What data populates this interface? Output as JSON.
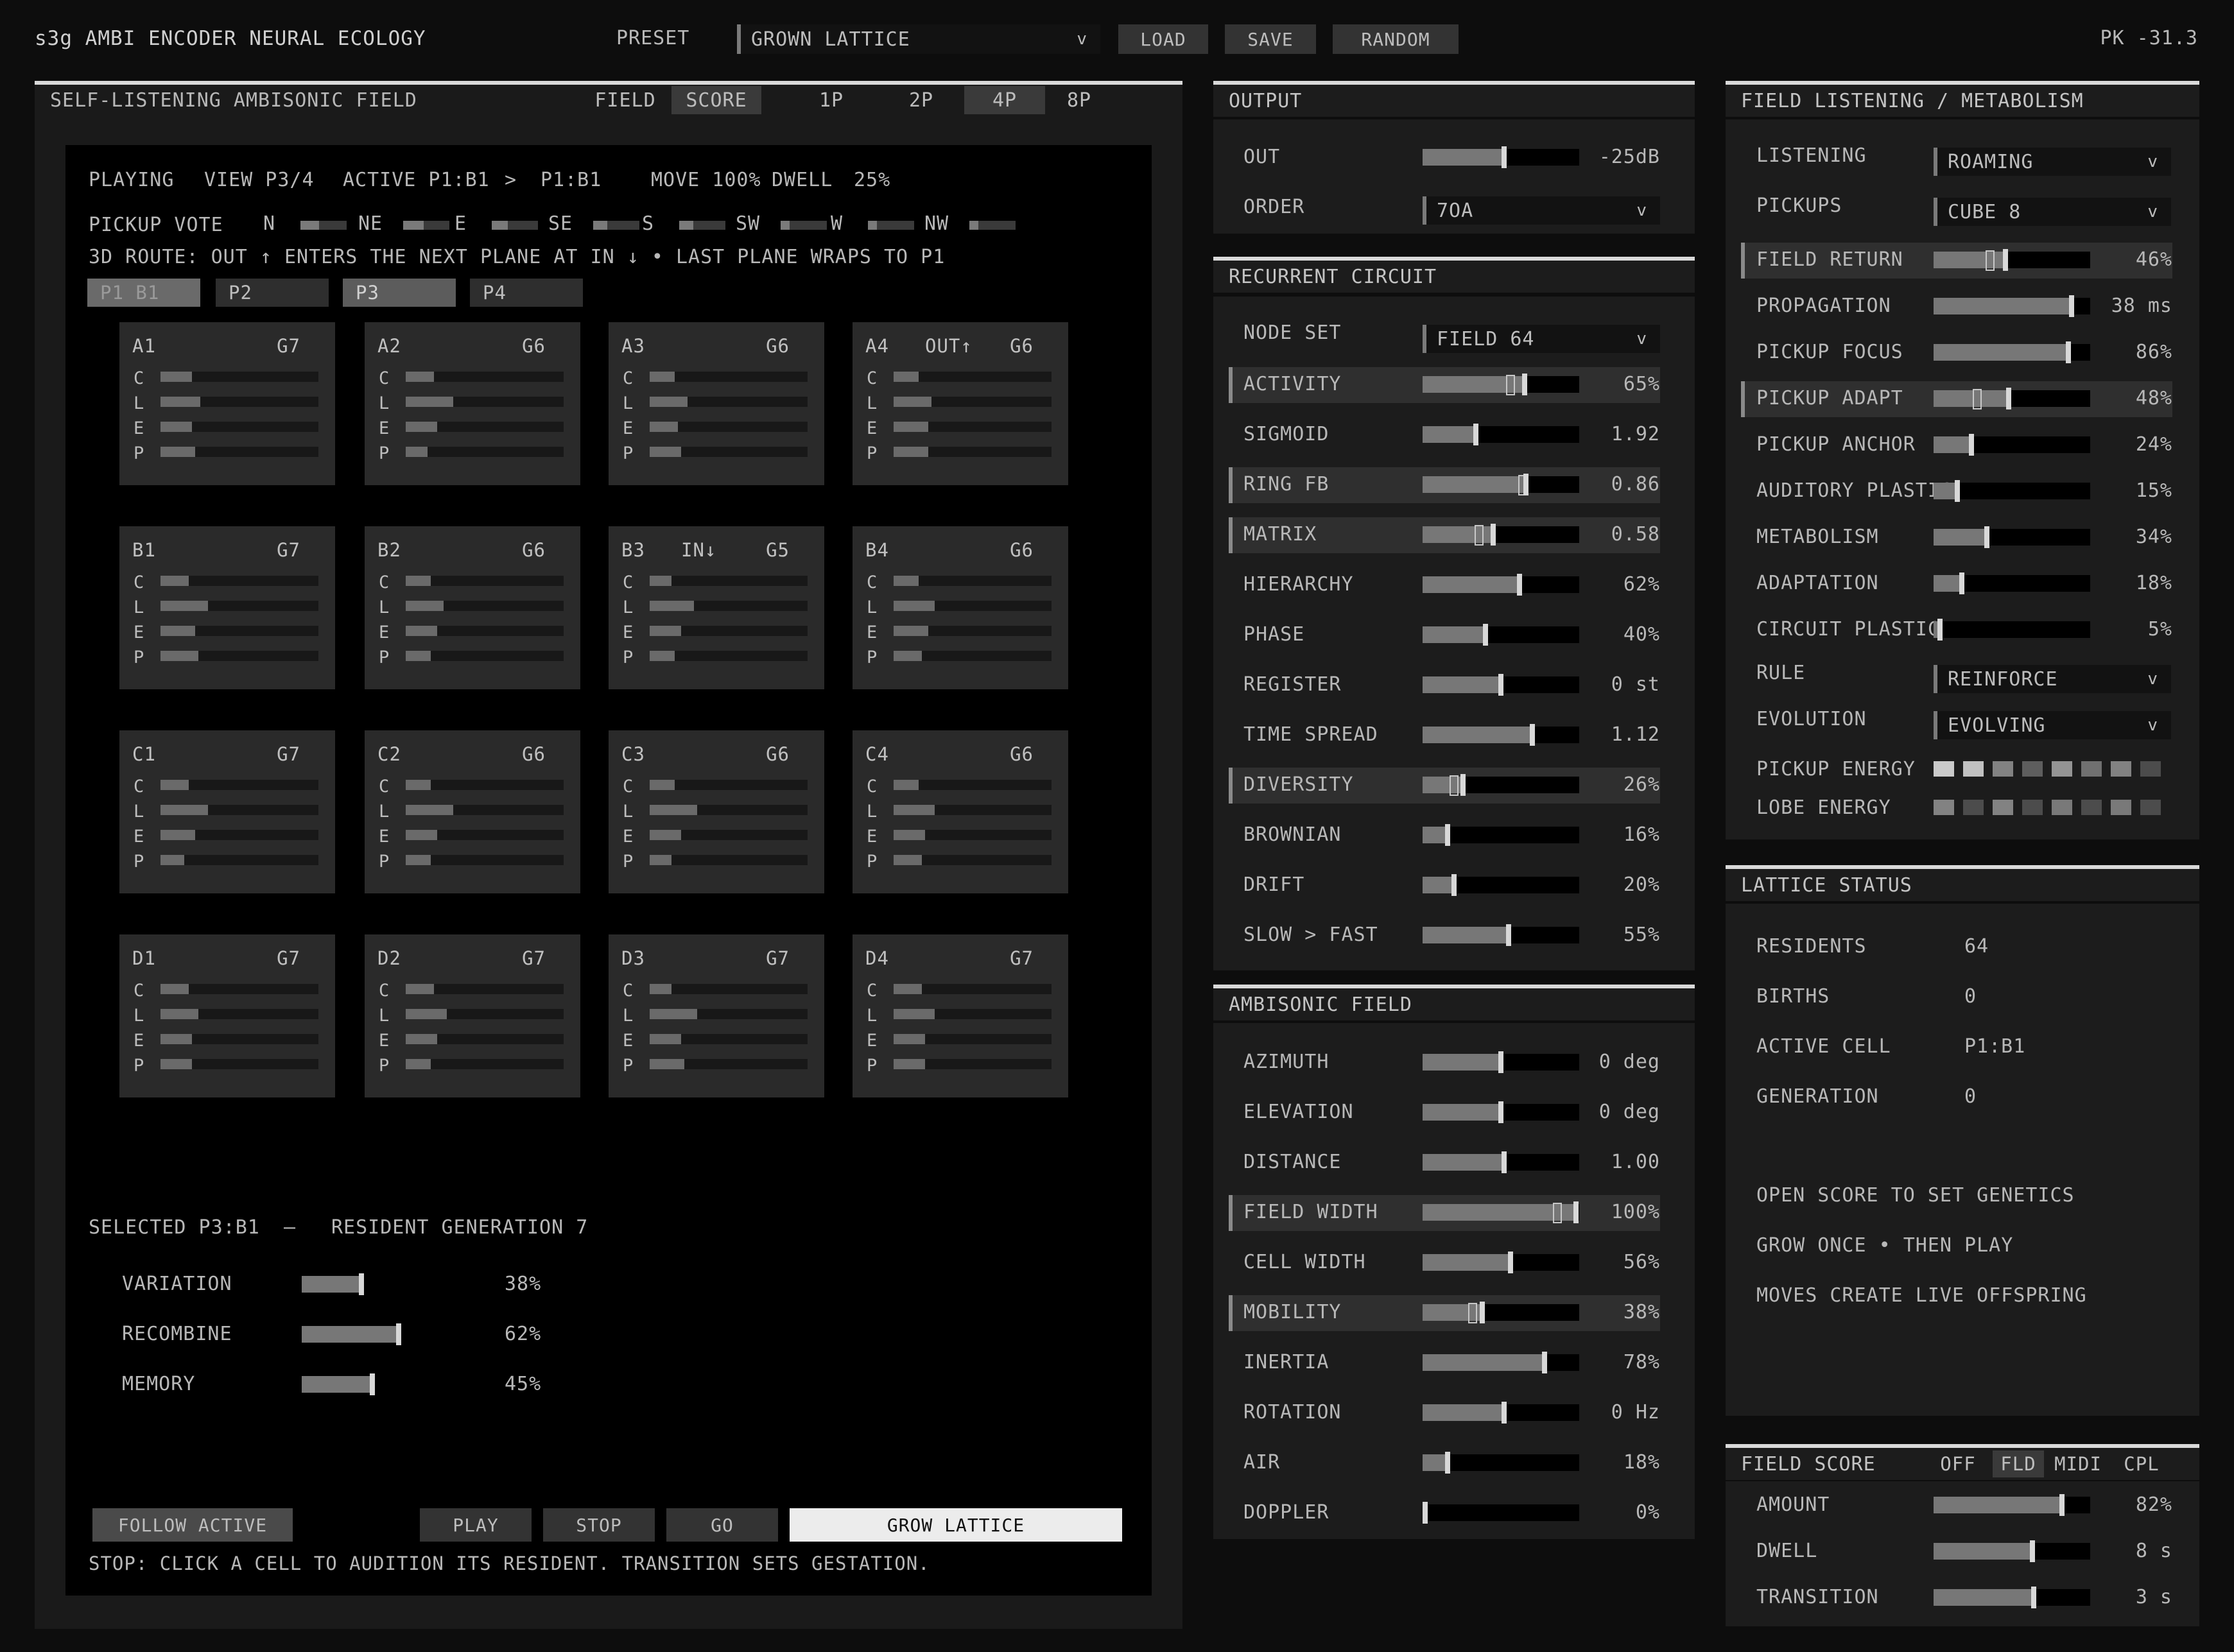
{
  "header": {
    "title": "s3g AMBI ENCODER NEURAL ECOLOGY",
    "preset_label": "PRESET",
    "preset_value": "GROWN LATTICE",
    "load": "LOAD",
    "save": "SAVE",
    "random": "RANDOM",
    "peak": "PK -31.3"
  },
  "left": {
    "title": "SELF-LISTENING AMBISONIC FIELD",
    "tabs": [
      "FIELD",
      "SCORE"
    ],
    "tab_active": "SCORE",
    "pickup_modes": [
      "1P",
      "2P",
      "4P",
      "8P"
    ],
    "pickup_active": "4P",
    "status": {
      "playing": "PLAYING",
      "view": "VIEW P3/4",
      "active": "ACTIVE P1:B1",
      "arrow": ">",
      "target": "P1:B1",
      "move": "MOVE 100%",
      "dwell": "DWELL",
      "dwell_val": "25%"
    },
    "vote_label": "PICKUP VOTE",
    "votes": [
      {
        "dir": "N",
        "value": 0.4
      },
      {
        "dir": "NE",
        "value": 0.45
      },
      {
        "dir": "E",
        "value": 0.35
      },
      {
        "dir": "SE",
        "value": 0.3
      },
      {
        "dir": "S",
        "value": 0.3
      },
      {
        "dir": "SW",
        "value": 0.2
      },
      {
        "dir": "W",
        "value": 0.2
      },
      {
        "dir": "NW",
        "value": 0.2
      }
    ],
    "route": "3D ROUTE: OUT ↑ ENTERS THE NEXT PLANE AT IN ↓  •  LAST PLANE WRAPS TO P1",
    "planes": [
      "P1 B1",
      "P2",
      "P3",
      "P4"
    ],
    "cell_rows": [
      "C",
      "L",
      "E",
      "P"
    ],
    "cells": [
      {
        "name": "A1",
        "g": "G7",
        "tag": "",
        "v": [
          0.2,
          0.25,
          0.2,
          0.22
        ]
      },
      {
        "name": "A2",
        "g": "G6",
        "tag": "",
        "v": [
          0.18,
          0.3,
          0.2,
          0.14
        ]
      },
      {
        "name": "A3",
        "g": "G6",
        "tag": "",
        "v": [
          0.16,
          0.24,
          0.18,
          0.2
        ]
      },
      {
        "name": "A4",
        "g": "G6",
        "tag": "OUT↑",
        "v": [
          0.16,
          0.24,
          0.22,
          0.22
        ]
      },
      {
        "name": "B1",
        "g": "G7",
        "tag": "",
        "v": [
          0.18,
          0.3,
          0.22,
          0.24
        ]
      },
      {
        "name": "B2",
        "g": "G6",
        "tag": "",
        "v": [
          0.16,
          0.24,
          0.2,
          0.16
        ]
      },
      {
        "name": "B3",
        "g": "G5",
        "tag": "IN↓",
        "v": [
          0.14,
          0.28,
          0.2,
          0.16
        ]
      },
      {
        "name": "B4",
        "g": "G6",
        "tag": "",
        "v": [
          0.16,
          0.26,
          0.22,
          0.18
        ]
      },
      {
        "name": "C1",
        "g": "G7",
        "tag": "",
        "v": [
          0.18,
          0.3,
          0.22,
          0.15
        ]
      },
      {
        "name": "C2",
        "g": "G6",
        "tag": "",
        "v": [
          0.16,
          0.3,
          0.2,
          0.16
        ]
      },
      {
        "name": "C3",
        "g": "G6",
        "tag": "",
        "v": [
          0.16,
          0.3,
          0.2,
          0.14
        ]
      },
      {
        "name": "C4",
        "g": "G6",
        "tag": "",
        "v": [
          0.16,
          0.26,
          0.2,
          0.18
        ]
      },
      {
        "name": "D1",
        "g": "G7",
        "tag": "",
        "v": [
          0.18,
          0.24,
          0.2,
          0.2
        ]
      },
      {
        "name": "D2",
        "g": "G7",
        "tag": "",
        "v": [
          0.18,
          0.26,
          0.2,
          0.16
        ]
      },
      {
        "name": "D3",
        "g": "G7",
        "tag": "",
        "v": [
          0.14,
          0.3,
          0.2,
          0.22
        ]
      },
      {
        "name": "D4",
        "g": "G7",
        "tag": "",
        "v": [
          0.18,
          0.26,
          0.2,
          0.2
        ]
      }
    ],
    "selected": {
      "id": "SELECTED P3:B1",
      "dash": "—",
      "resident": "RESIDENT GENERATION 7"
    },
    "genes": [
      {
        "label": "VARIATION",
        "value": 0.38,
        "text": "38%"
      },
      {
        "label": "RECOMBINE",
        "value": 0.62,
        "text": "62%"
      },
      {
        "label": "MEMORY",
        "value": 0.45,
        "text": "45%"
      }
    ],
    "buttons": {
      "follow": "FOLLOW ACTIVE",
      "play": "PLAY",
      "stop": "STOP",
      "go": "GO",
      "grow": "GROW LATTICE"
    },
    "help": "STOP: CLICK A CELL TO AUDITION ITS RESIDENT.  TRANSITION SETS GESTATION."
  },
  "output": {
    "title": "OUTPUT",
    "out_label": "OUT",
    "out_value": 0.52,
    "out_text": "-25dB",
    "order_label": "ORDER",
    "order_value": "7OA"
  },
  "circuit": {
    "title": "RECURRENT CIRCUIT",
    "nodeset_label": "NODE SET",
    "nodeset_value": "FIELD 64",
    "params": [
      {
        "label": "ACTIVITY",
        "value": 0.65,
        "text": "65%",
        "hl": true,
        "ghost": 0.56
      },
      {
        "label": "SIGMOID",
        "value": 0.34,
        "text": "1.92",
        "hl": false
      },
      {
        "label": "RING FB",
        "value": 0.66,
        "text": "0.86",
        "hl": true,
        "ghost": 0.64
      },
      {
        "label": "MATRIX",
        "value": 0.45,
        "text": "0.58",
        "hl": true,
        "ghost": 0.36
      },
      {
        "label": "HIERARCHY",
        "value": 0.62,
        "text": "62%",
        "hl": false
      },
      {
        "label": "PHASE",
        "value": 0.4,
        "text": "40%",
        "hl": false
      },
      {
        "label": "REGISTER",
        "value": 0.5,
        "text": "0 st",
        "hl": false
      },
      {
        "label": "TIME SPREAD",
        "value": 0.7,
        "text": "1.12",
        "hl": false
      },
      {
        "label": "DIVERSITY",
        "value": 0.26,
        "text": "26%",
        "hl": true,
        "ghost": 0.2
      },
      {
        "label": "BROWNIAN",
        "value": 0.16,
        "text": "16%",
        "hl": false
      },
      {
        "label": "DRIFT",
        "value": 0.2,
        "text": "20%",
        "hl": false
      },
      {
        "label": "SLOW > FAST",
        "value": 0.55,
        "text": "55%",
        "hl": false
      }
    ]
  },
  "ambisonic": {
    "title": "AMBISONIC FIELD",
    "params": [
      {
        "label": "AZIMUTH",
        "value": 0.5,
        "text": "0 deg",
        "hl": false
      },
      {
        "label": "ELEVATION",
        "value": 0.5,
        "text": "0 deg",
        "hl": false
      },
      {
        "label": "DISTANCE",
        "value": 0.52,
        "text": "1.00",
        "hl": false
      },
      {
        "label": "FIELD WIDTH",
        "value": 0.98,
        "text": "100%",
        "hl": true,
        "ghost": 0.86
      },
      {
        "label": "CELL WIDTH",
        "value": 0.56,
        "text": "56%",
        "hl": false
      },
      {
        "label": "MOBILITY",
        "value": 0.38,
        "text": "38%",
        "hl": true,
        "ghost": 0.32
      },
      {
        "label": "INERTIA",
        "value": 0.78,
        "text": "78%",
        "hl": false
      },
      {
        "label": "ROTATION",
        "value": 0.52,
        "text": "0 Hz",
        "hl": false
      },
      {
        "label": "AIR",
        "value": 0.16,
        "text": "18%",
        "hl": false
      },
      {
        "label": "DOPPLER",
        "value": 0.01,
        "text": "0%",
        "hl": false
      }
    ]
  },
  "listening": {
    "title": "FIELD LISTENING / METABOLISM",
    "listening_label": "LISTENING",
    "listening_value": "ROAMING",
    "pickups_label": "PICKUPS",
    "pickups_value": "CUBE 8",
    "params": [
      {
        "label": "FIELD RETURN",
        "value": 0.46,
        "text": "46%",
        "hl": true,
        "ghost": 0.36
      },
      {
        "label": "PROPAGATION",
        "value": 0.88,
        "text": "38 ms",
        "hl": false
      },
      {
        "label": "PICKUP FOCUS",
        "value": 0.86,
        "text": "86%",
        "hl": false
      },
      {
        "label": "PICKUP ADAPT",
        "value": 0.48,
        "text": "48%",
        "hl": true,
        "ghost": 0.28
      },
      {
        "label": "PICKUP ANCHOR",
        "value": 0.24,
        "text": "24%",
        "hl": false
      },
      {
        "label": "AUDITORY PLASTIC",
        "value": 0.15,
        "text": "15%",
        "hl": false
      },
      {
        "label": "METABOLISM",
        "value": 0.34,
        "text": "34%",
        "hl": false
      },
      {
        "label": "ADAPTATION",
        "value": 0.18,
        "text": "18%",
        "hl": false
      },
      {
        "label": "CIRCUIT PLASTIC",
        "value": 0.04,
        "text": "5%",
        "hl": false
      }
    ],
    "rule_label": "RULE",
    "rule_value": "REINFORCE",
    "evolution_label": "EVOLUTION",
    "evolution_value": "EVOLVING",
    "pickup_energy_label": "PICKUP ENERGY",
    "pickup_energy": [
      0.9,
      0.85,
      0.5,
      0.3,
      0.6,
      0.4,
      0.5,
      0.2
    ],
    "lobe_energy_label": "LOBE ENERGY",
    "lobe_energy": [
      0.5,
      0.2,
      0.5,
      0.2,
      0.45,
      0.2,
      0.45,
      0.2
    ]
  },
  "lattice": {
    "title": "LATTICE STATUS",
    "rows": [
      {
        "label": "RESIDENTS",
        "value": "64"
      },
      {
        "label": "BIRTHS",
        "value": "0"
      },
      {
        "label": "ACTIVE CELL",
        "value": "P1:B1"
      },
      {
        "label": "GENERATION",
        "value": "0"
      }
    ],
    "notes": [
      "OPEN SCORE TO SET GENETICS",
      "GROW ONCE • THEN PLAY",
      "MOVES CREATE LIVE OFFSPRING"
    ]
  },
  "fieldscore": {
    "title": "FIELD SCORE",
    "modes": [
      "OFF",
      "FLD",
      "MIDI",
      "CPL"
    ],
    "mode_active": "FLD",
    "params": [
      {
        "label": "AMOUNT",
        "value": 0.82,
        "text": "82%"
      },
      {
        "label": "DWELL",
        "value": 0.63,
        "text": "8 s"
      },
      {
        "label": "TRANSITION",
        "value": 0.64,
        "text": "3 s"
      }
    ]
  }
}
